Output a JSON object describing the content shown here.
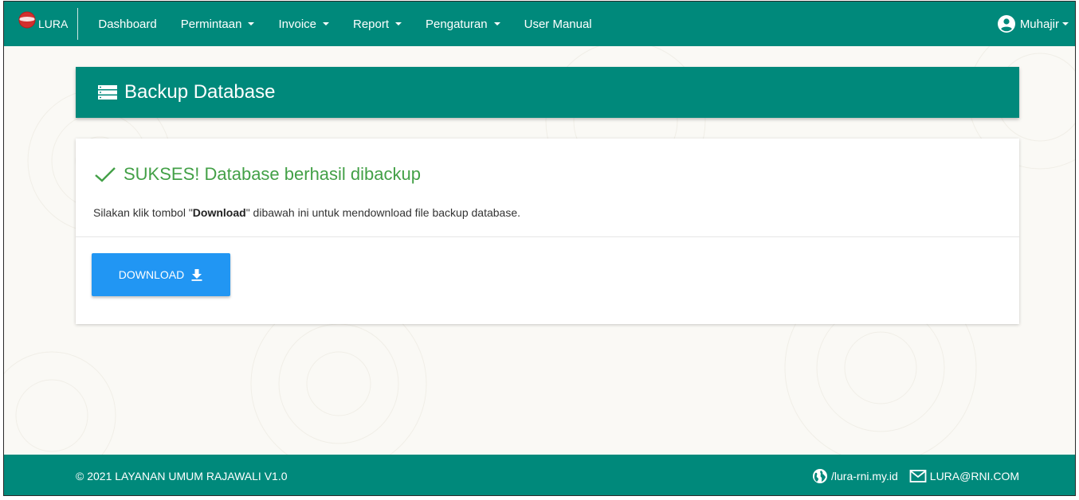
{
  "brand": {
    "name": "LURA"
  },
  "nav": {
    "items": [
      {
        "label": "Dashboard"
      },
      {
        "label": "Permintaan"
      },
      {
        "label": "Invoice"
      },
      {
        "label": "Report"
      },
      {
        "label": "Pengaturan"
      },
      {
        "label": "User Manual"
      }
    ],
    "user": "Muhajir"
  },
  "header": {
    "title": "Backup Database",
    "icon": "list-icon"
  },
  "content": {
    "success_message": "SUKSES! Database berhasil dibackup",
    "desc_prefix": "Silakan klik tombol \"",
    "desc_bold": "Download",
    "desc_suffix": "\" dibawah ini untuk mendownload file backup database.",
    "download_label": "DOWNLOAD"
  },
  "footer": {
    "copyright": "© 2021 LAYANAN UMUM RAJAWALI V1.0",
    "website": "/lura-rni.my.id",
    "email": "LURA@RNI.COM"
  },
  "colors": {
    "primary": "#00897b",
    "success": "#43a047",
    "button": "#2196f3"
  }
}
